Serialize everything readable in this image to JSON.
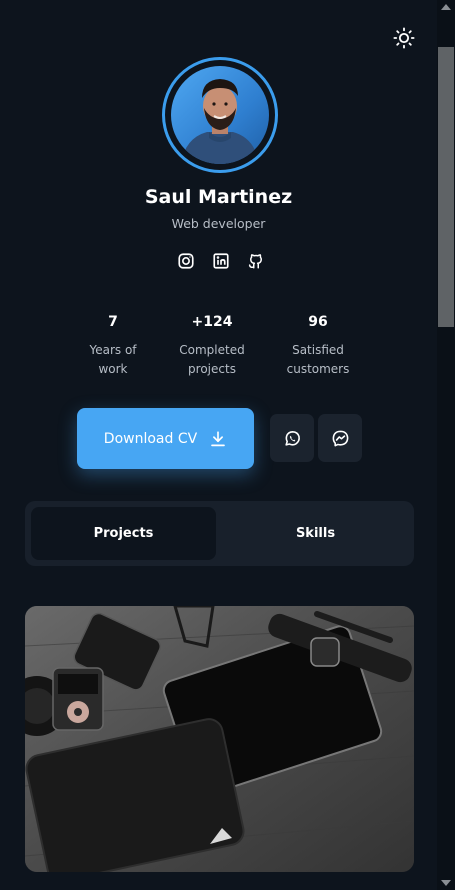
{
  "profile": {
    "name": "Saul Martinez",
    "role": "Web developer"
  },
  "socials": [
    {
      "icon": "instagram-icon"
    },
    {
      "icon": "linkedin-icon"
    },
    {
      "icon": "github-icon"
    }
  ],
  "stats": [
    {
      "value": "7",
      "label_line1": "Years of",
      "label_line2": "work"
    },
    {
      "value": "+124",
      "label_line1": "Completed",
      "label_line2": "projects"
    },
    {
      "value": "96",
      "label_line1": "Satisfied",
      "label_line2": "customers"
    }
  ],
  "actions": {
    "download_label": "Download CV",
    "whatsapp_icon": "whatsapp-icon",
    "messenger_icon": "messenger-icon"
  },
  "tabs": [
    {
      "label": "Projects",
      "active": true
    },
    {
      "label": "Skills",
      "active": false
    }
  ],
  "colors": {
    "background": "#0d141d",
    "accent": "#47a6f3",
    "panel": "#18202b"
  }
}
